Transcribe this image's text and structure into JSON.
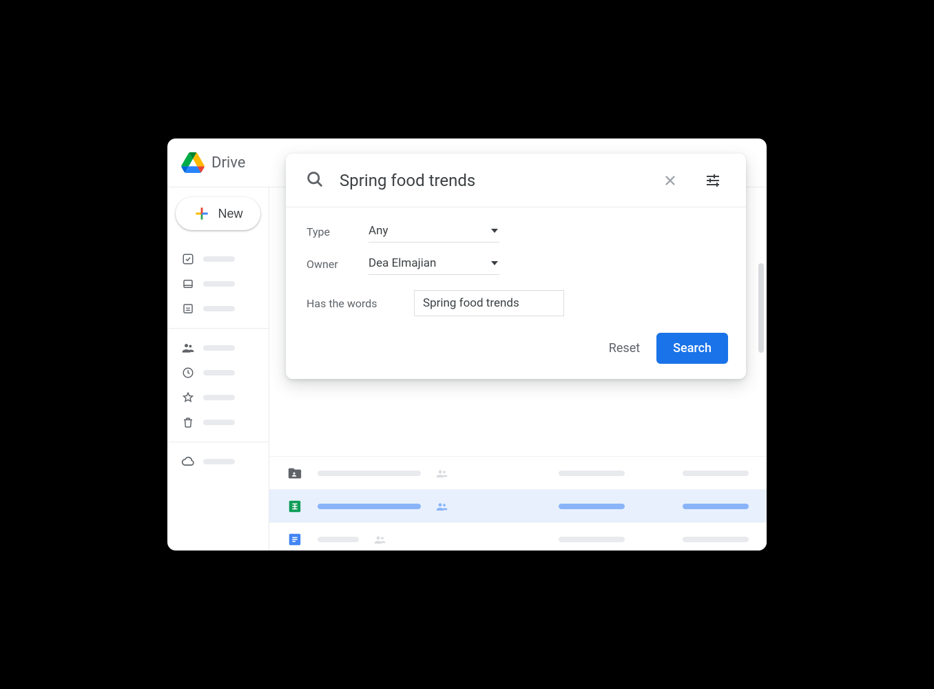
{
  "header": {
    "app_name": "Drive"
  },
  "sidebar": {
    "new_label": "New"
  },
  "search": {
    "query": "Spring food trends",
    "filters": {
      "type_label": "Type",
      "type_value": "Any",
      "owner_label": "Owner",
      "owner_value": "Dea Elmajian",
      "words_label": "Has the words",
      "words_value": "Spring food trends"
    },
    "reset_label": "Reset",
    "search_label": "Search"
  },
  "files": {
    "rows": [
      {
        "type": "folder",
        "selected": false
      },
      {
        "type": "sheets",
        "selected": true
      },
      {
        "type": "docs",
        "selected": false
      }
    ]
  }
}
